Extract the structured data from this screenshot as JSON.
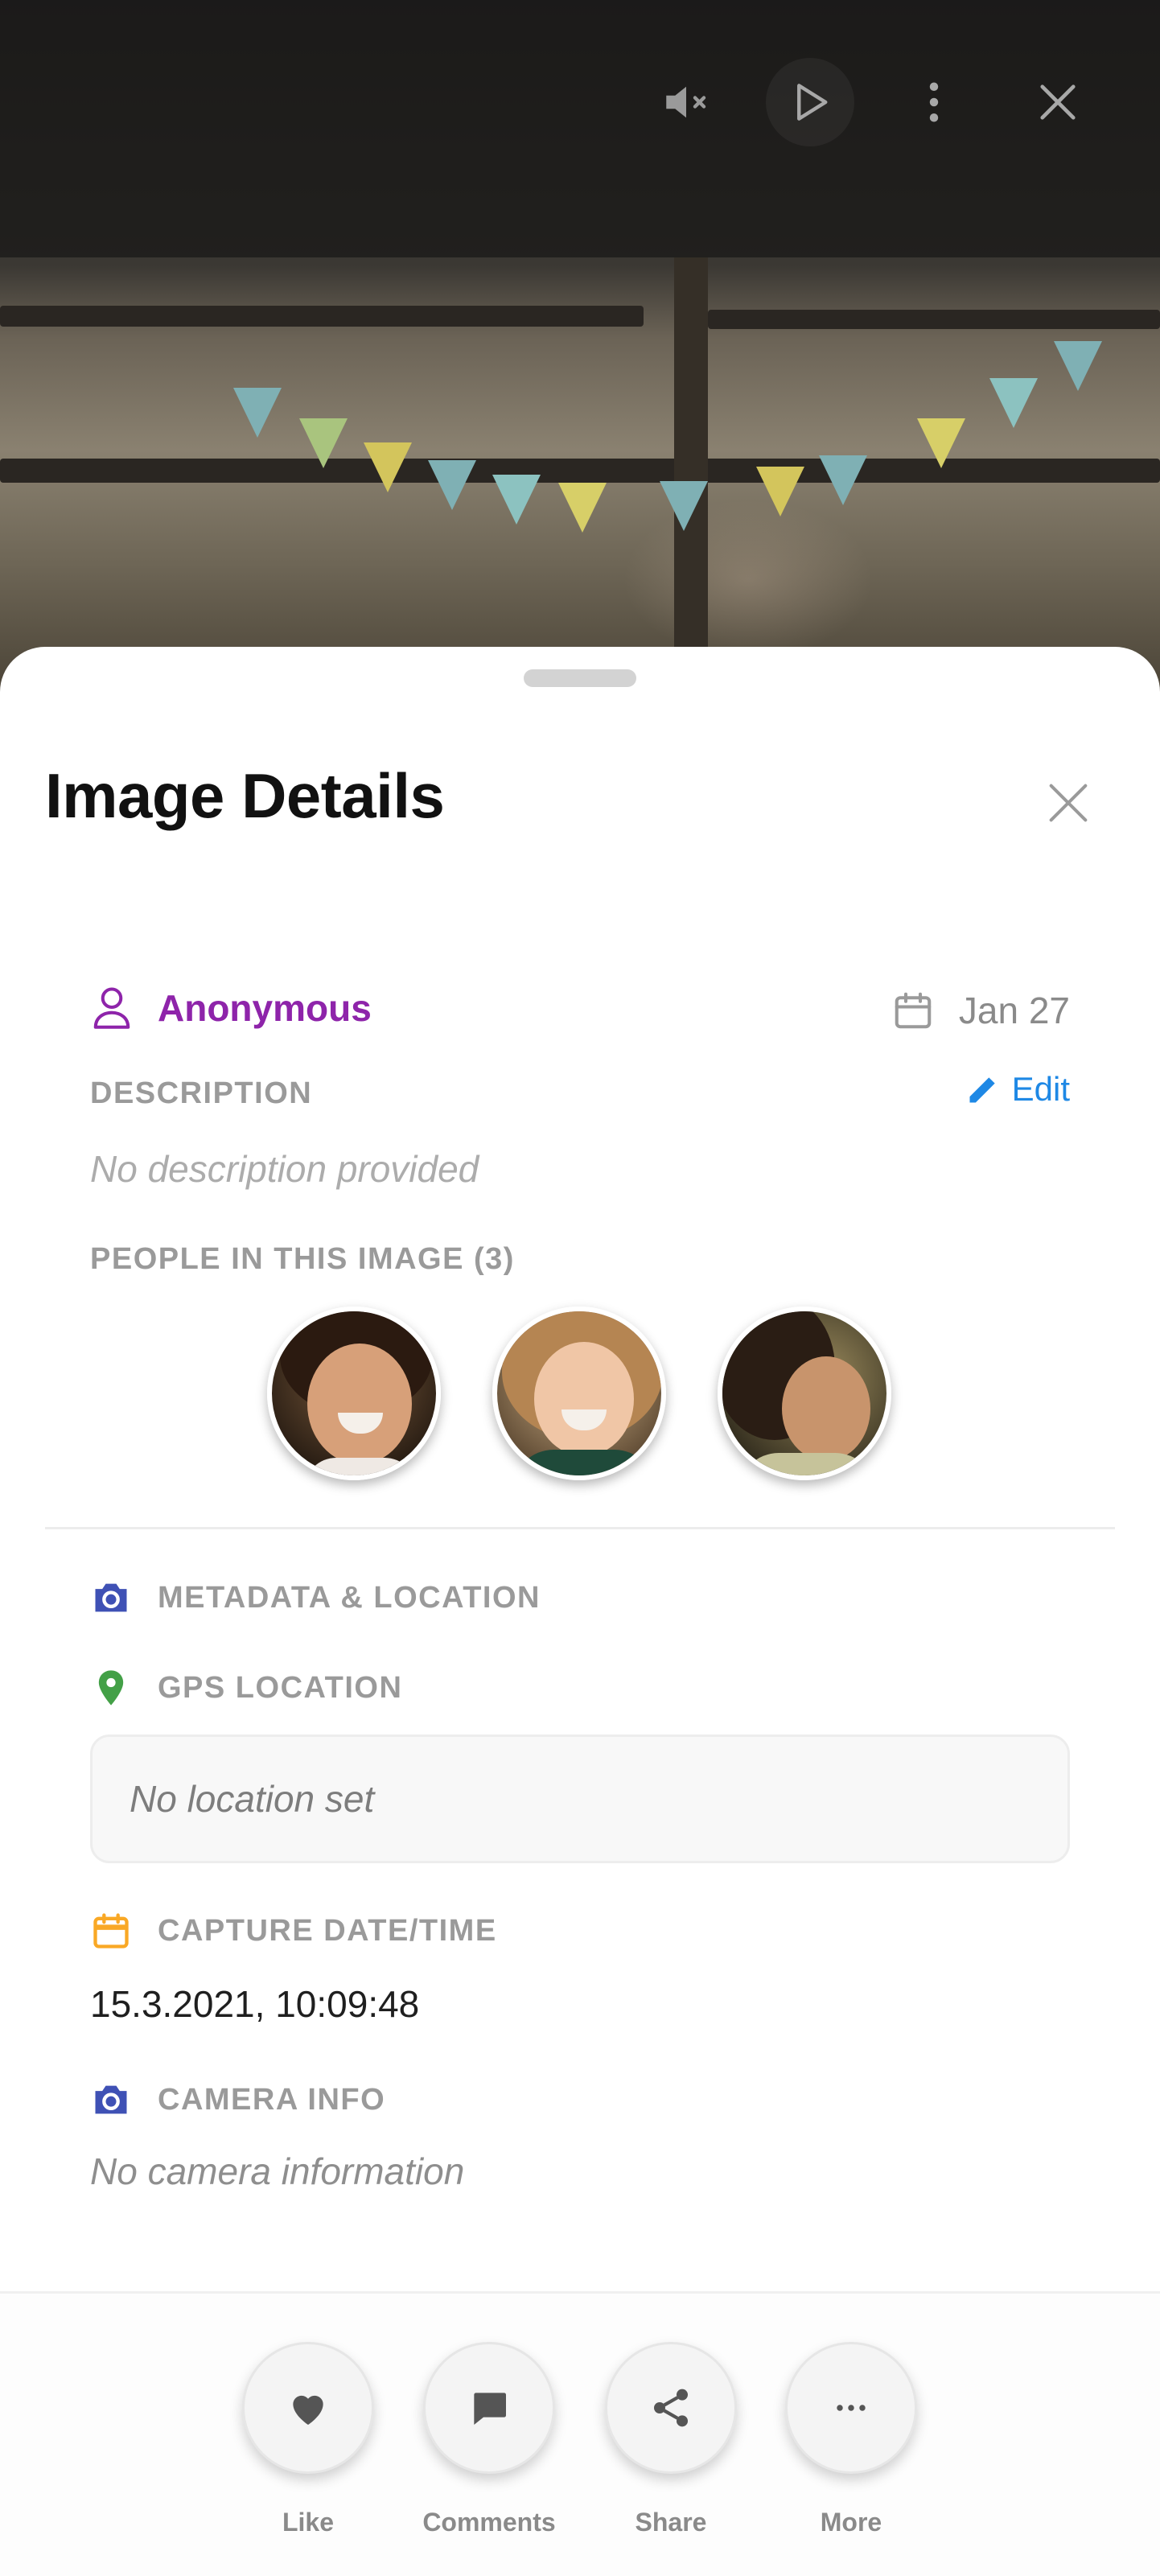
{
  "sheet": {
    "title": "Image Details",
    "author": {
      "name": "Anonymous",
      "color": "#8e24aa"
    },
    "date": "Jan 27",
    "description": {
      "label": "DESCRIPTION",
      "edit_label": "Edit",
      "placeholder": "No description provided"
    },
    "people": {
      "label": "PEOPLE IN THIS IMAGE (3)"
    },
    "metadata": {
      "section_label": "METADATA & LOCATION",
      "gps_label": "GPS LOCATION",
      "gps_value": "No location set",
      "capture_label": "CAPTURE DATE/TIME",
      "capture_value": "15.3.2021, 10:09:48",
      "camera_label": "CAMERA INFO",
      "camera_value": "No camera information"
    }
  },
  "actions": [
    {
      "label": "Like",
      "icon": "heart-icon"
    },
    {
      "label": "Comments",
      "icon": "comment-icon"
    },
    {
      "label": "Share",
      "icon": "share-icon"
    },
    {
      "label": "More",
      "icon": "more-horizontal-icon"
    }
  ],
  "topbar_icons": [
    "mute-icon",
    "play-icon",
    "more-vertical-icon",
    "close-icon"
  ],
  "colors": {
    "accent_purple": "#8e24aa",
    "link_blue": "#1e88e5",
    "camera_indigo": "#3f51b5",
    "gps_green": "#43a047",
    "calendar_orange": "#f9a825"
  }
}
